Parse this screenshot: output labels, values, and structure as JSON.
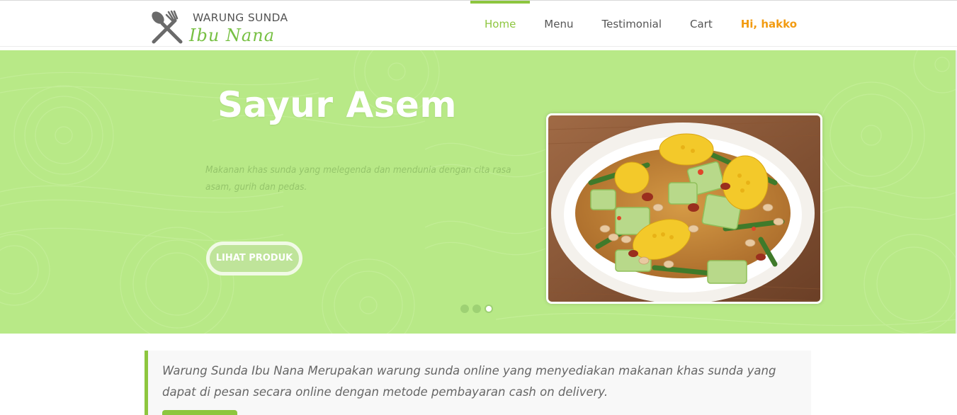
{
  "brand": {
    "name_line1": "WARUNG SUNDA",
    "name_line2": "Ibu Nana",
    "logo_icon": "fork-spoon-icon",
    "accent_color": "#77c043"
  },
  "nav": {
    "items": [
      {
        "label": "Home",
        "active": true
      },
      {
        "label": "Menu",
        "active": false
      },
      {
        "label": "Testimonial",
        "active": false
      },
      {
        "label": "Cart",
        "active": false
      }
    ],
    "user_greeting": "Hi, hakko",
    "active_color": "#8dc63f",
    "user_color": "#f29b11"
  },
  "hero": {
    "title": "Sayur Asem",
    "description": "Makanan khas sunda yang melegenda dan mendunia dengan cita rasa asam, gurih dan pedas.",
    "button_label": "LIHAT PRODUK",
    "background_color": "#b8e987",
    "slide_count": 3,
    "active_slide": 3
  },
  "intro": {
    "text": "Warung Sunda Ibu Nana Merupakan warung sunda online yang menyediakan makanan khas sunda yang dapat di pesan secara online dengan metode pembayaran cash on delivery.",
    "button_color": "#8dc63f"
  }
}
